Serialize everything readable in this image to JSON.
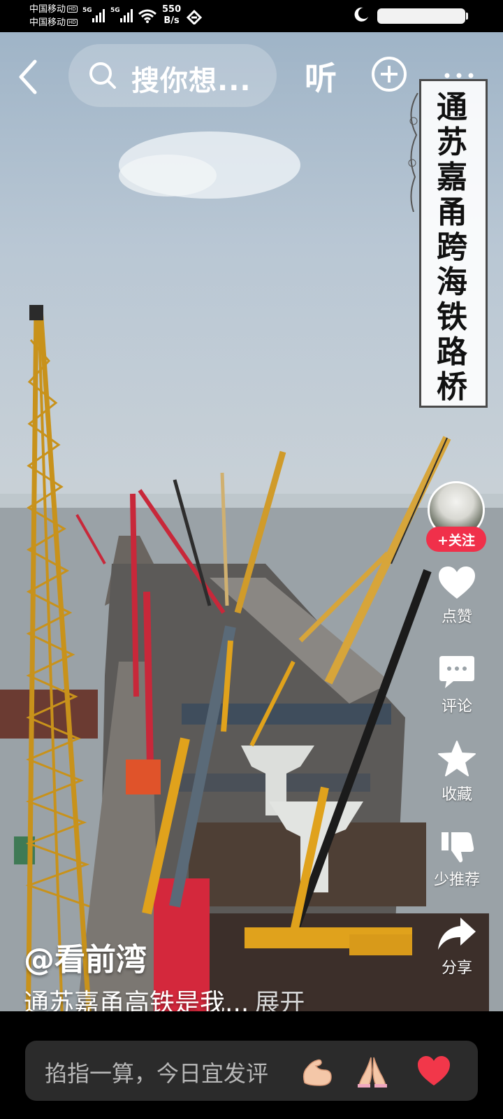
{
  "status_bar": {
    "carrier_1": "中国移动",
    "carrier_2": "中国移动",
    "hd_badge": "HD",
    "network_type": "5G",
    "net_speed_value": "550",
    "net_speed_unit": "B/s",
    "battery_level": null
  },
  "top_bar": {
    "search_placeholder": "搜你想...",
    "listen_label": "听"
  },
  "video": {
    "title_banner": "通苏嘉甬跨海铁路桥",
    "progress_fraction": 0.5
  },
  "side_actions": {
    "follow_label": "+关注",
    "like_label": "点赞",
    "comment_label": "评论",
    "favorite_label": "收藏",
    "less_recommend_label": "少推荐",
    "share_label": "分享"
  },
  "caption": {
    "author": "@看前湾",
    "text": "通苏嘉甬高铁是我...",
    "expand_label": "展开"
  },
  "comment_bar": {
    "placeholder": "掐指一算，今日宜发评",
    "emojis": [
      "muscle-emoji",
      "pray-emoji",
      "heart-emoji"
    ]
  },
  "colors": {
    "follow_red": "#f0304a",
    "crane_yellow": "#e0a21c",
    "crane_red": "#c8283a",
    "heart_red": "#f2374a"
  }
}
